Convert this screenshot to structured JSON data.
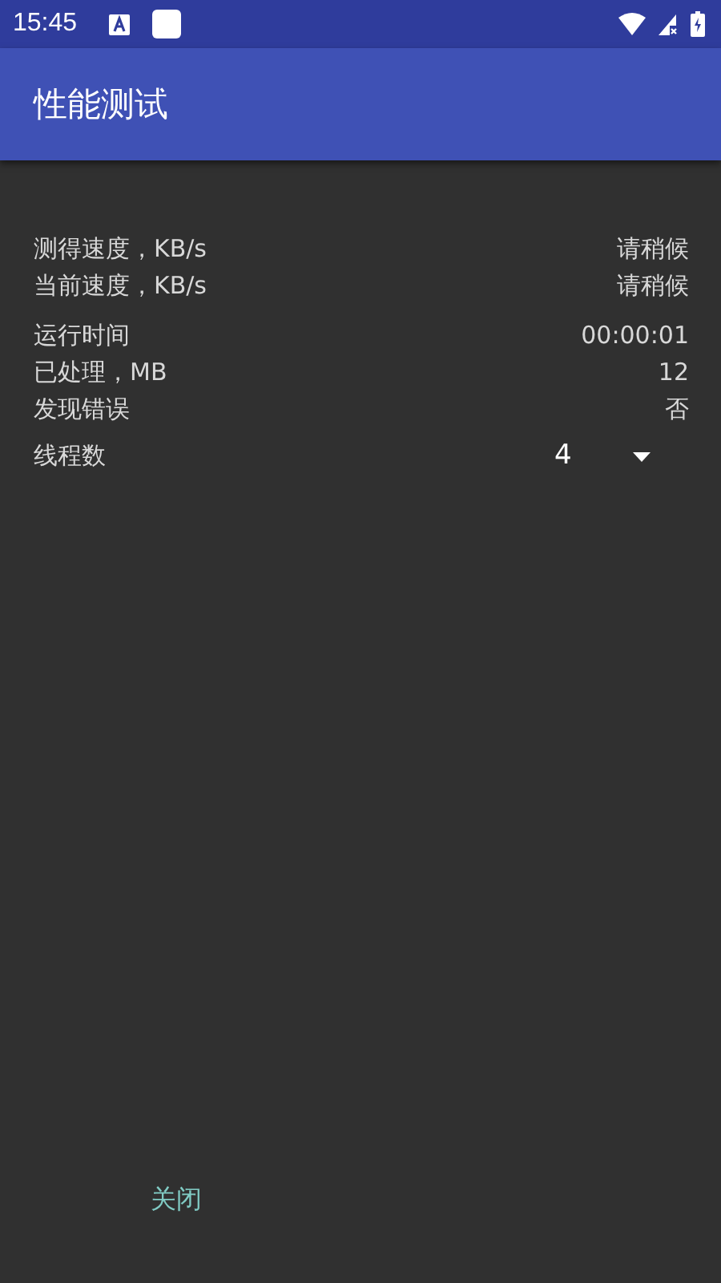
{
  "status_bar": {
    "time": "15:45"
  },
  "app_bar": {
    "title": "性能测试"
  },
  "groups": [
    [
      {
        "label": "测得速度，KB/s",
        "value": "请稍候"
      },
      {
        "label": "当前速度，KB/s",
        "value": "请稍候"
      }
    ],
    [
      {
        "label": "运行时间",
        "value": "00:00:01"
      },
      {
        "label": "已处理，MB",
        "value": "12"
      },
      {
        "label": "发现错误",
        "value": "否"
      }
    ]
  ],
  "threads": {
    "label": "线程数",
    "value": "4"
  },
  "close_button": "关闭"
}
